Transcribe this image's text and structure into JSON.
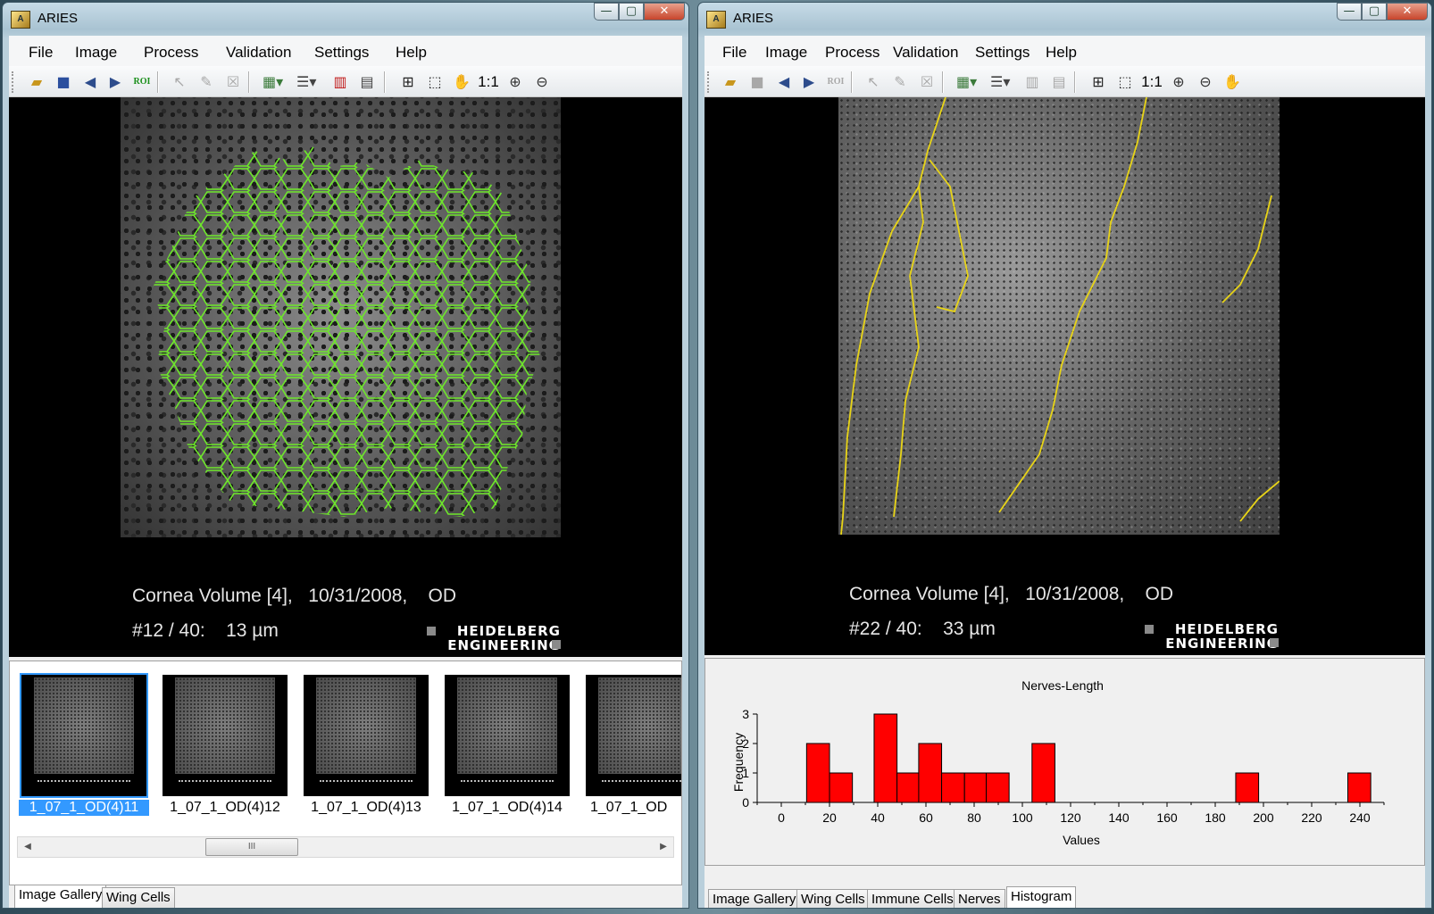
{
  "left_window": {
    "title": "ARIES",
    "menu": [
      "File",
      "Image",
      "Process",
      "Validation",
      "Settings",
      "Help"
    ],
    "toolbar": {
      "roi_label": "ROI",
      "zoom_label": "1:1"
    },
    "image_info": {
      "line1": "Cornea Volume [4],   10/31/2008,    OD",
      "line2": "#12 / 40:    13 µm"
    },
    "logo": {
      "line1": "HEIDELBERG",
      "line2": "ENGINEERING"
    },
    "thumbnails": [
      {
        "label": "1_07_1_OD(4)11",
        "selected": true
      },
      {
        "label": "1_07_1_OD(4)12",
        "selected": false
      },
      {
        "label": "1_07_1_OD(4)13",
        "selected": false
      },
      {
        "label": "1_07_1_OD(4)14",
        "selected": false
      },
      {
        "label": "1_07_1_OD",
        "selected": false
      }
    ],
    "scroll_thumb_grip": "III",
    "tabs": [
      "Image Gallery",
      "Wing Cells"
    ],
    "active_tab": "Image Gallery",
    "overlay_color": "#6ee82a"
  },
  "right_window": {
    "title": "ARIES",
    "menu": [
      "File",
      "Image",
      "Process",
      "Validation",
      "Settings",
      "Help"
    ],
    "toolbar": {
      "roi_label": "ROI",
      "zoom_label": "1:1"
    },
    "image_info": {
      "line1": "Cornea Volume [4],   10/31/2008,    OD",
      "line2": "#22 / 40:    33 µm"
    },
    "logo": {
      "line1": "HEIDELBERG",
      "line2": "ENGINEERING"
    },
    "tabs": [
      "Image Gallery",
      "Wing Cells",
      "Immune Cells",
      "Nerves",
      "Histogram"
    ],
    "active_tab": "Histogram",
    "overlay_color": "#e8d417"
  },
  "window_buttons": {
    "minimize": "—",
    "maximize": "▢",
    "close": "✕"
  },
  "chart_data": {
    "type": "bar",
    "title": "Nerves-Length",
    "xlabel": "Values",
    "ylabel": "Frequency",
    "xlim": [
      -10,
      250
    ],
    "ylim": [
      0,
      3
    ],
    "x_ticks": [
      0,
      20,
      40,
      60,
      80,
      100,
      120,
      140,
      160,
      180,
      200,
      220,
      240
    ],
    "y_ticks": [
      0,
      1,
      2,
      3
    ],
    "bin_width": 9.5,
    "bins": [
      {
        "start": 10.5,
        "count": 2
      },
      {
        "start": 20,
        "count": 1
      },
      {
        "start": 38.5,
        "count": 3
      },
      {
        "start": 48,
        "count": 1
      },
      {
        "start": 57,
        "count": 2
      },
      {
        "start": 66.5,
        "count": 1
      },
      {
        "start": 76,
        "count": 1
      },
      {
        "start": 85,
        "count": 1
      },
      {
        "start": 104,
        "count": 2
      },
      {
        "start": 188.5,
        "count": 1
      },
      {
        "start": 235,
        "count": 1
      }
    ],
    "bar_color": "#ff0000"
  }
}
